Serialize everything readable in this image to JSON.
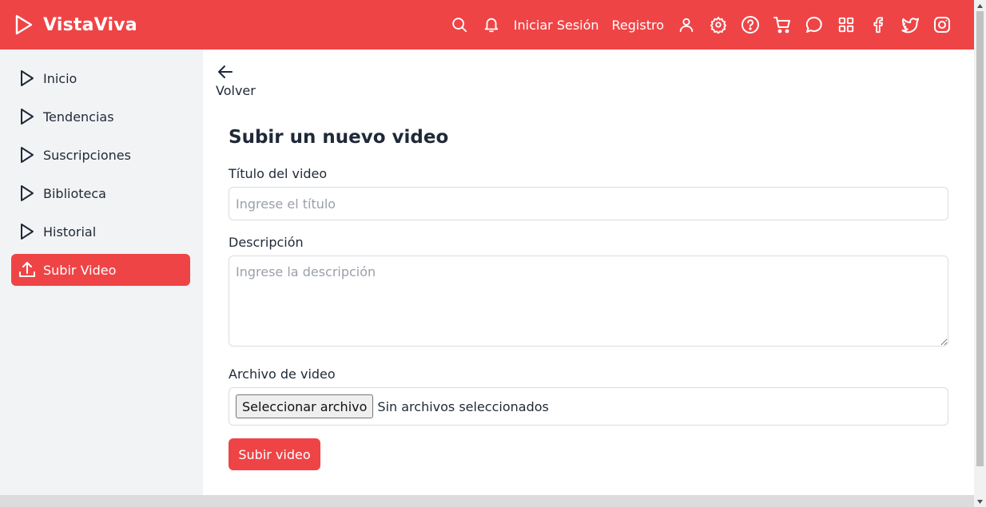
{
  "header": {
    "brand": "VistaViva",
    "login": "Iniciar Sesión",
    "register": "Registro",
    "icons": [
      "search-icon",
      "bell-icon",
      "user-icon",
      "gear-icon",
      "help-icon",
      "cart-icon",
      "chat-icon",
      "grid-icon",
      "facebook-icon",
      "twitter-icon",
      "instagram-icon"
    ]
  },
  "sidebar": {
    "items": [
      {
        "label": "Inicio",
        "icon": "play-icon"
      },
      {
        "label": "Tendencias",
        "icon": "play-icon"
      },
      {
        "label": "Suscripciones",
        "icon": "play-icon"
      },
      {
        "label": "Biblioteca",
        "icon": "play-icon"
      },
      {
        "label": "Historial",
        "icon": "play-icon"
      },
      {
        "label": "Subir Video",
        "icon": "upload-icon",
        "active": true
      }
    ]
  },
  "main": {
    "back_label": "Volver",
    "title": "Subir un nuevo video",
    "title_label": "Título del video",
    "title_placeholder": "Ingrese el título",
    "description_label": "Descripción",
    "description_placeholder": "Ingrese la descripción",
    "file_label": "Archivo de video",
    "file_button": "Seleccionar archivo",
    "file_status": "Sin archivos seleccionados",
    "submit_label": "Subir video"
  },
  "colors": {
    "accent": "#ef4446",
    "sidebar_bg": "#f2f3f5",
    "text": "#1f2937",
    "placeholder": "#9aa0a8"
  }
}
